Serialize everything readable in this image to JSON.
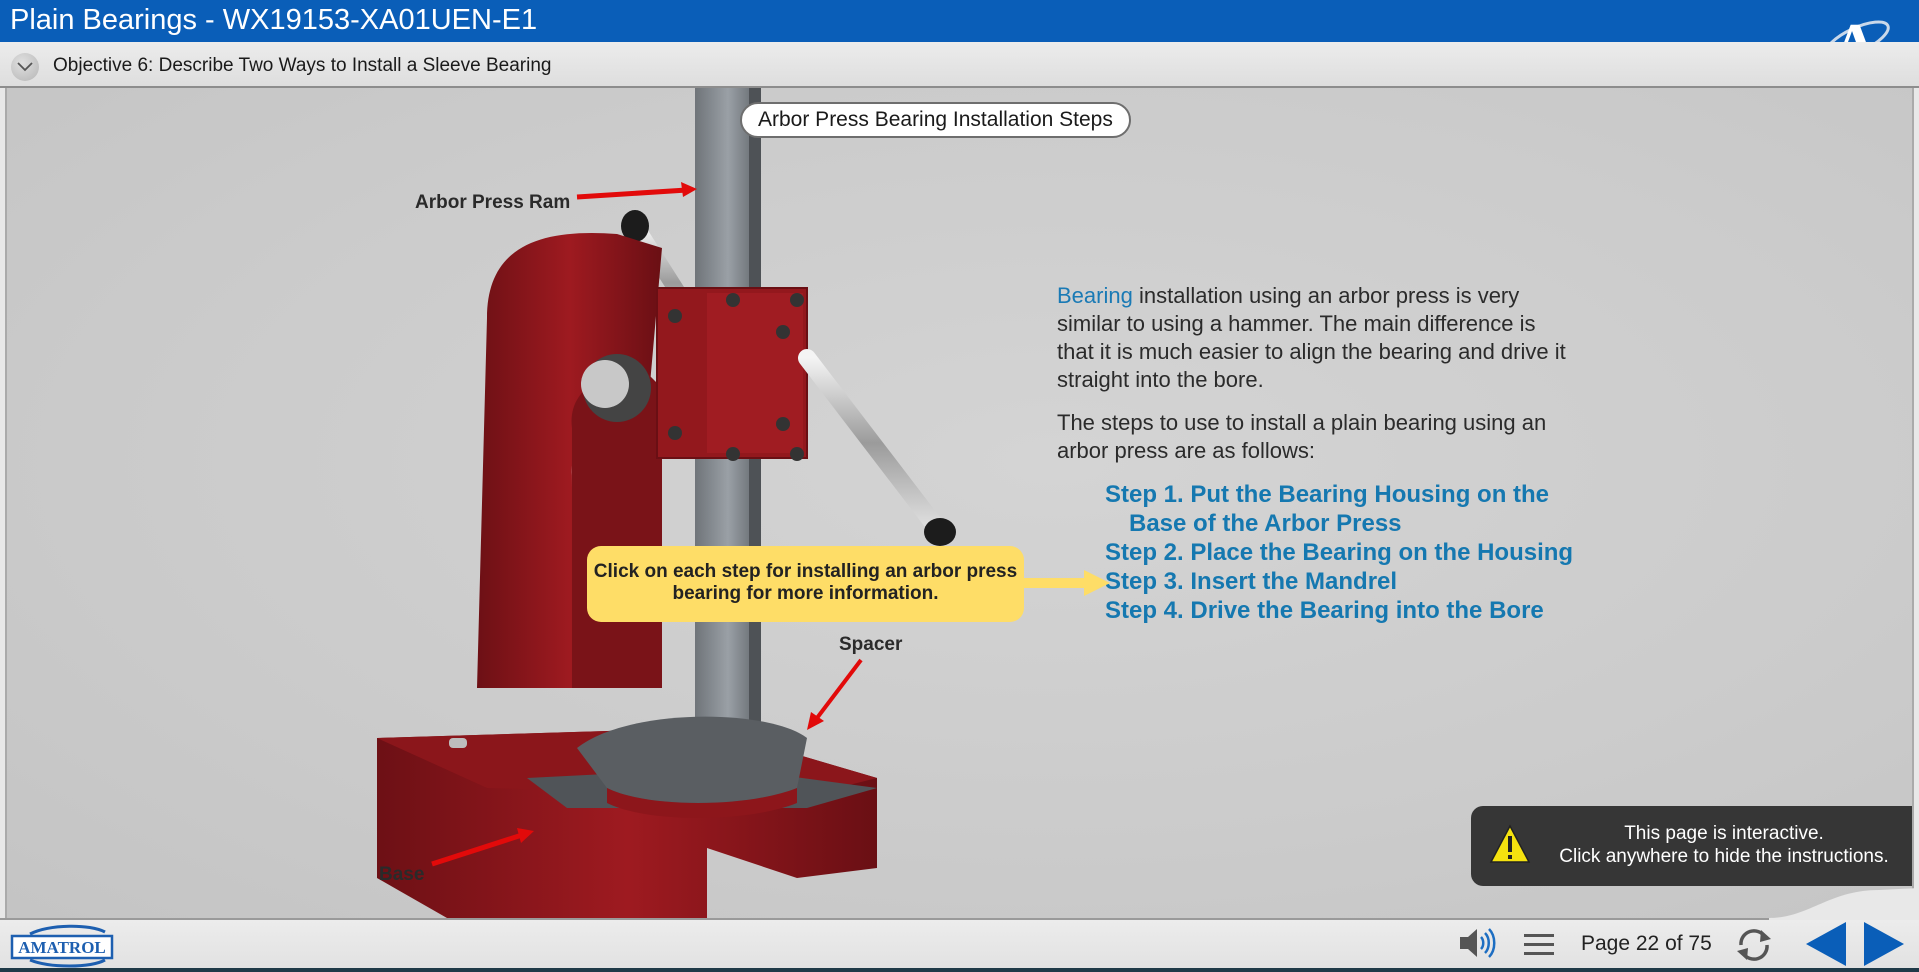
{
  "header": {
    "title": "Plain Bearings - WX19153-XA01UEN-E1",
    "brand_logo": "A"
  },
  "objective": {
    "toggle_icon": "chevron-down-icon",
    "title": "Objective 6: Describe Two Ways to Install a Sleeve Bearing"
  },
  "main": {
    "section_title": "Arbor Press Bearing Installation Steps",
    "labels": {
      "ram": "Arbor Press Ram",
      "spacer": "Spacer",
      "base": "Base"
    },
    "intro": {
      "term": "Bearing",
      "rest": " installation using an arbor press is very similar to using a hammer. The main difference is that it is much easier to align the bearing and drive it straight into the bore."
    },
    "steps_intro": "The steps to use to install a plain bearing using an arbor press are as follows:",
    "steps": [
      {
        "label": "Step 1. Put the Bearing Housing on the Base of the Arbor Press"
      },
      {
        "label": "Step 2. Place the Bearing on the Housing"
      },
      {
        "label": "Step 3. Insert the Mandrel"
      },
      {
        "label": "Step 4. Drive the Bearing into the Bore"
      }
    ],
    "hint": "Click on each step for installing an arbor press bearing for more information.",
    "notice": {
      "line1": "This page is interactive.",
      "line2": "Click anywhere to hide the instructions."
    }
  },
  "footer": {
    "brand": "AMATROL",
    "page_indicator": "Page 22 of 75",
    "icons": [
      "speaker-icon",
      "menu-icon",
      "refresh-icon",
      "previous-icon",
      "next-icon"
    ]
  },
  "colors": {
    "header_blue": "#0a5eb8",
    "step_blue": "#1578b0",
    "hint_yellow": "#fedd67",
    "callout_red": "#e20a0a",
    "notice_bg": "#363636"
  }
}
